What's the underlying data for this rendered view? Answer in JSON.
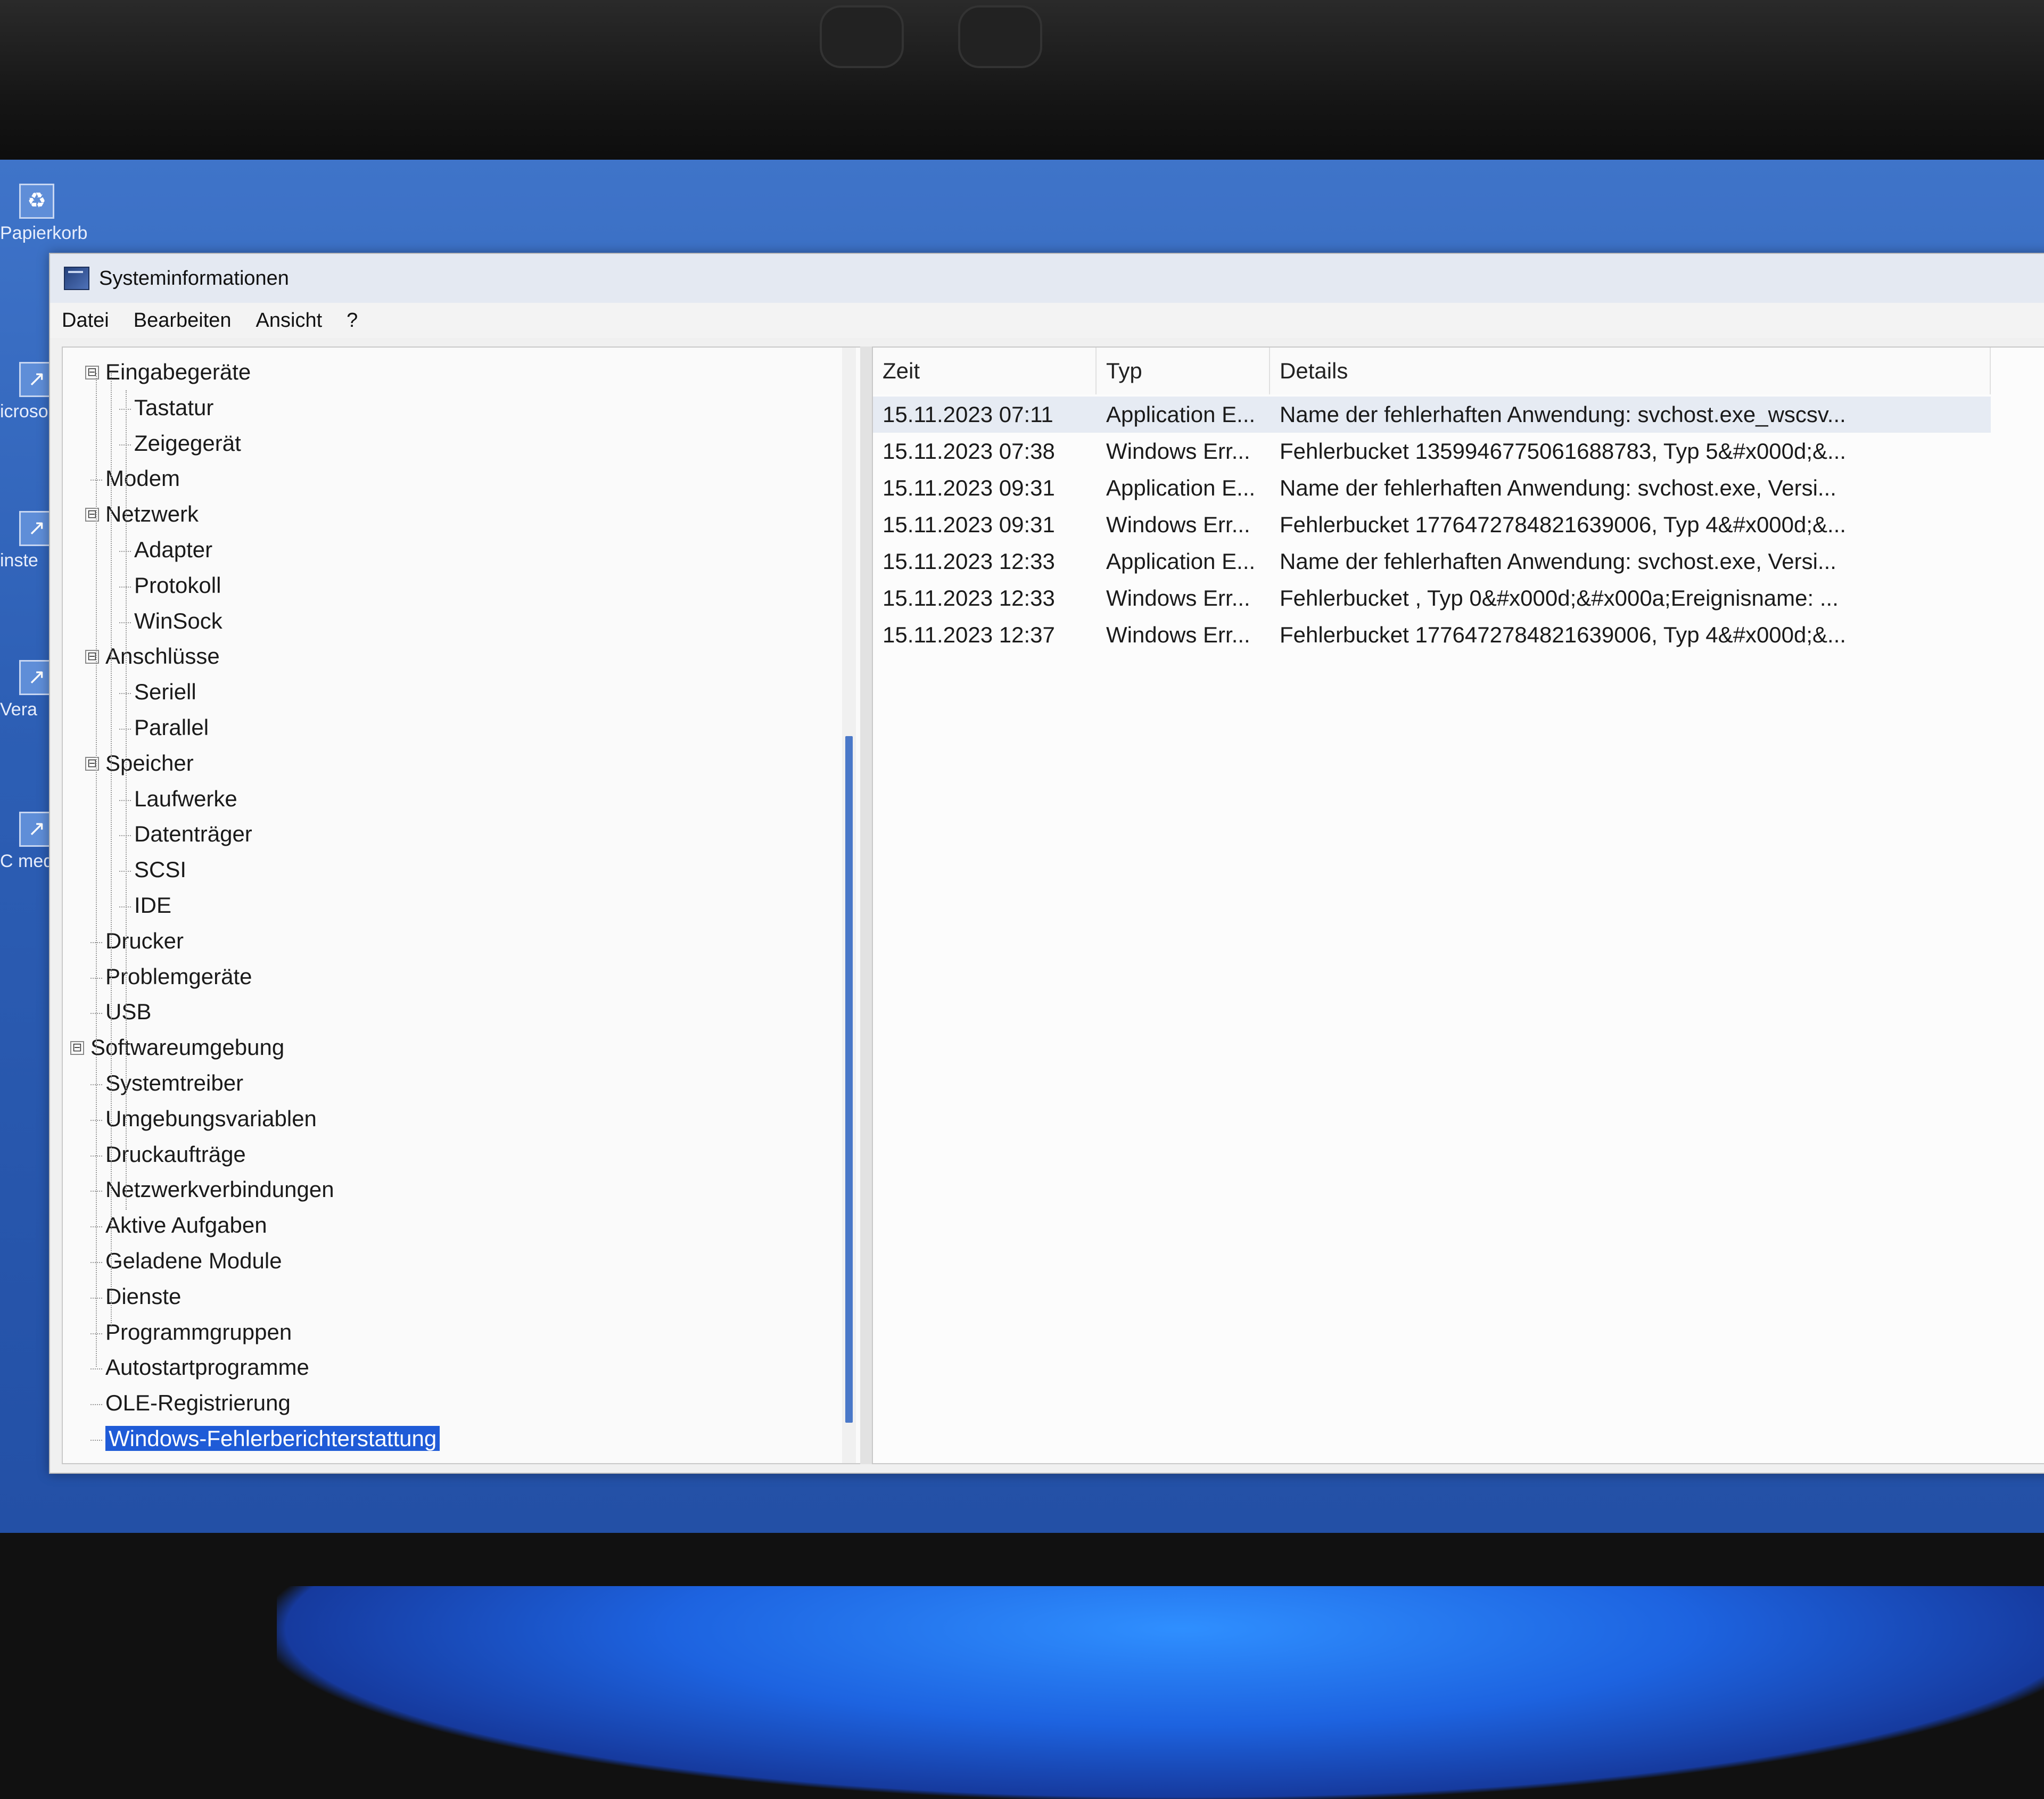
{
  "desktop": {
    "icons": [
      {
        "label": "Papierkorb",
        "icon": "recycle-bin-icon"
      },
      {
        "label": "icroso",
        "icon": "shortcut-icon"
      },
      {
        "label": "inste",
        "icon": "shortcut-icon"
      },
      {
        "label": "Vera",
        "icon": "shortcut-icon"
      },
      {
        "label": "C med",
        "icon": "shortcut-icon"
      }
    ]
  },
  "window": {
    "title": "Systeminformationen",
    "menu": [
      "Datei",
      "Bearbeiten",
      "Ansicht",
      "?"
    ]
  },
  "tree": [
    {
      "label": "Eingabegeräte",
      "level": 1,
      "expander": "⊟"
    },
    {
      "label": "Tastatur",
      "level": 2
    },
    {
      "label": "Zeigegerät",
      "level": 2
    },
    {
      "label": "Modem",
      "level": 1
    },
    {
      "label": "Netzwerk",
      "level": 1,
      "expander": "⊟"
    },
    {
      "label": "Adapter",
      "level": 2
    },
    {
      "label": "Protokoll",
      "level": 2
    },
    {
      "label": "WinSock",
      "level": 2
    },
    {
      "label": "Anschlüsse",
      "level": 1,
      "expander": "⊟"
    },
    {
      "label": "Seriell",
      "level": 2
    },
    {
      "label": "Parallel",
      "level": 2
    },
    {
      "label": "Speicher",
      "level": 1,
      "expander": "⊟"
    },
    {
      "label": "Laufwerke",
      "level": 2
    },
    {
      "label": "Datenträger",
      "level": 2
    },
    {
      "label": "SCSI",
      "level": 2
    },
    {
      "label": "IDE",
      "level": 2
    },
    {
      "label": "Drucker",
      "level": 1
    },
    {
      "label": "Problemgeräte",
      "level": 1
    },
    {
      "label": "USB",
      "level": 1
    },
    {
      "label": "Softwareumgebung",
      "level": 0,
      "expander": "⊟"
    },
    {
      "label": "Systemtreiber",
      "level": 1
    },
    {
      "label": "Umgebungsvariablen",
      "level": 1
    },
    {
      "label": "Druckaufträge",
      "level": 1
    },
    {
      "label": "Netzwerkverbindungen",
      "level": 1
    },
    {
      "label": "Aktive Aufgaben",
      "level": 1
    },
    {
      "label": "Geladene Module",
      "level": 1
    },
    {
      "label": "Dienste",
      "level": 1
    },
    {
      "label": "Programmgruppen",
      "level": 1
    },
    {
      "label": "Autostartprogramme",
      "level": 1
    },
    {
      "label": "OLE-Registrierung",
      "level": 1
    },
    {
      "label": "Windows-Fehlerberichterstattung",
      "level": 1,
      "selected": true
    }
  ],
  "list": {
    "columns": [
      "Zeit",
      "Typ",
      "Details"
    ],
    "rows": [
      [
        "15.11.2023 07:11",
        "Application E...",
        "Name der fehlerhaften Anwendung: svchost.exe_wscsv..."
      ],
      [
        "15.11.2023 07:38",
        "Windows Err...",
        "Fehlerbucket 1359946775061688783, Typ 5&#x000d;&..."
      ],
      [
        "15.11.2023 09:31",
        "Application E...",
        "Name der fehlerhaften Anwendung: svchost.exe, Versi..."
      ],
      [
        "15.11.2023 09:31",
        "Windows Err...",
        "Fehlerbucket 1776472784821639006, Typ 4&#x000d;&..."
      ],
      [
        "15.11.2023 12:33",
        "Application E...",
        "Name der fehlerhaften Anwendung: svchost.exe, Versi..."
      ],
      [
        "15.11.2023 12:33",
        "Windows Err...",
        "Fehlerbucket , Typ 0&#x000d;&#x000a;Ereignisname: ..."
      ],
      [
        "15.11.2023 12:37",
        "Windows Err...",
        "Fehlerbucket 1776472784821639006, Typ 4&#x000d;&..."
      ]
    ]
  },
  "colors": {
    "selection": "#1f5bd7",
    "scrollbar": "#4a78c8",
    "desktop": "#2d5fb5"
  }
}
